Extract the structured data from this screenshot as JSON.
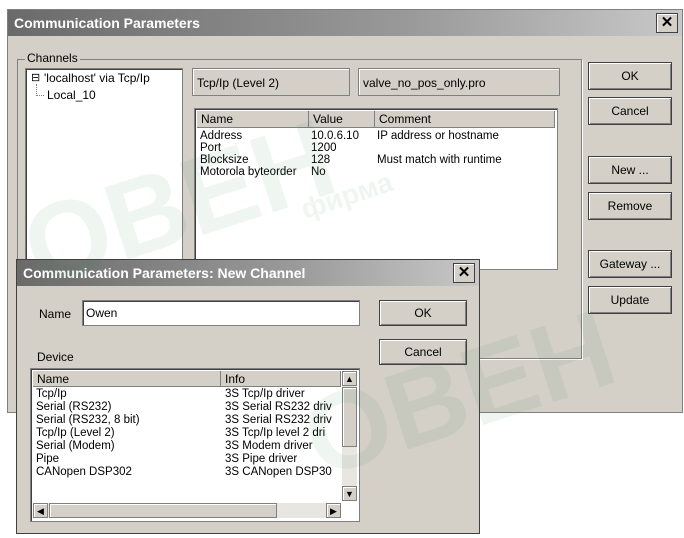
{
  "main_dialog": {
    "title": "Communication Parameters",
    "close_glyph": "✕",
    "channels_label": "Channels",
    "tree": {
      "root": "'localhost' via Tcp/Ip",
      "root_toggle": "⊟",
      "child": "Local_10"
    },
    "driver_field": "Tcp/Ip (Level 2)",
    "project_field": "valve_no_pos_only.pro",
    "params_table": {
      "headers": {
        "name": "Name",
        "value": "Value",
        "comment": "Comment"
      },
      "rows": [
        {
          "name": "Address",
          "value": "10.0.6.10",
          "comment": "IP address or hostname"
        },
        {
          "name": "Port",
          "value": "1200",
          "comment": ""
        },
        {
          "name": "Blocksize",
          "value": "128",
          "comment": "Must match with runtime"
        },
        {
          "name": "Motorola byteorder",
          "value": "No",
          "comment": ""
        }
      ]
    },
    "buttons": {
      "ok": "OK",
      "cancel": "Cancel",
      "new": "New ...",
      "remove": "Remove",
      "gateway": "Gateway ...",
      "update": "Update"
    }
  },
  "new_channel_dialog": {
    "title": "Communication Parameters: New Channel",
    "close_glyph": "✕",
    "name_label": "Name",
    "name_value": "Owen",
    "ok": "OK",
    "cancel": "Cancel",
    "device_label": "Device",
    "device_table": {
      "headers": {
        "name": "Name",
        "info": "Info"
      },
      "rows": [
        {
          "name": "Tcp/Ip",
          "info": "3S Tcp/Ip driver"
        },
        {
          "name": "Serial (RS232)",
          "info": "3S Serial RS232 driv"
        },
        {
          "name": "Serial (RS232, 8 bit)",
          "info": "3S Serial RS232 driv"
        },
        {
          "name": "Tcp/Ip (Level 2)",
          "info": "3S Tcp/Ip level 2 dri"
        },
        {
          "name": "Serial (Modem)",
          "info": "3S Modem driver"
        },
        {
          "name": "Pipe",
          "info": "3S Pipe driver"
        },
        {
          "name": "CANopen DSP302",
          "info": "3S CANopen DSP30"
        }
      ]
    },
    "scroll_glyphs": {
      "up": "▲",
      "down": "▼",
      "left": "◀",
      "right": "▶"
    }
  },
  "watermark": {
    "a": "ОВЕН",
    "b": "фирма",
    "c": "ОВЕН"
  }
}
